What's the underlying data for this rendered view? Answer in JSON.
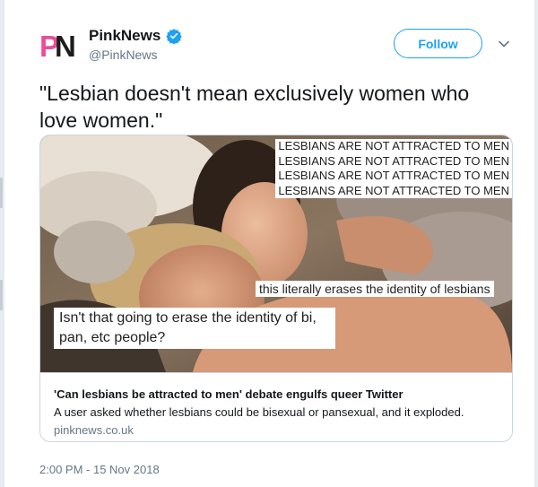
{
  "account": {
    "name": "PinkNews",
    "handle": "@PinkNews",
    "logo_text": "PN",
    "verified_icon": "verified-badge-icon",
    "brand_colors": {
      "pink": "#e94f9a",
      "dark": "#1d1d1b"
    }
  },
  "actions": {
    "follow_label": "Follow",
    "menu_icon": "chevron-down-icon"
  },
  "tweet": {
    "text": "\"Lesbian doesn't mean exclusively women who love women.\"",
    "timestamp": "2:00 PM - 15 Nov 2018"
  },
  "card": {
    "image_captions": {
      "repeated": [
        "LESBIANS ARE NOT ATTRACTED TO MEN",
        "LESBIANS ARE NOT ATTRACTED TO MEN",
        "LESBIANS ARE NOT ATTRACTED TO MEN",
        "LESBIANS ARE NOT ATTRACTED TO MEN"
      ],
      "middle": "this literally erases the identity of lesbians",
      "lower": "Isn't that going to erase the identity of bi, pan, etc people?"
    },
    "title": "'Can lesbians be attracted to men' debate engulfs queer Twitter",
    "description": "A user asked whether lesbians could be bisexual or pansexual, and it exploded.",
    "domain": "pinknews.co.uk"
  },
  "colors": {
    "accent": "#1da1f2",
    "secondary_text": "#657786",
    "border": "#ccd6dd"
  }
}
